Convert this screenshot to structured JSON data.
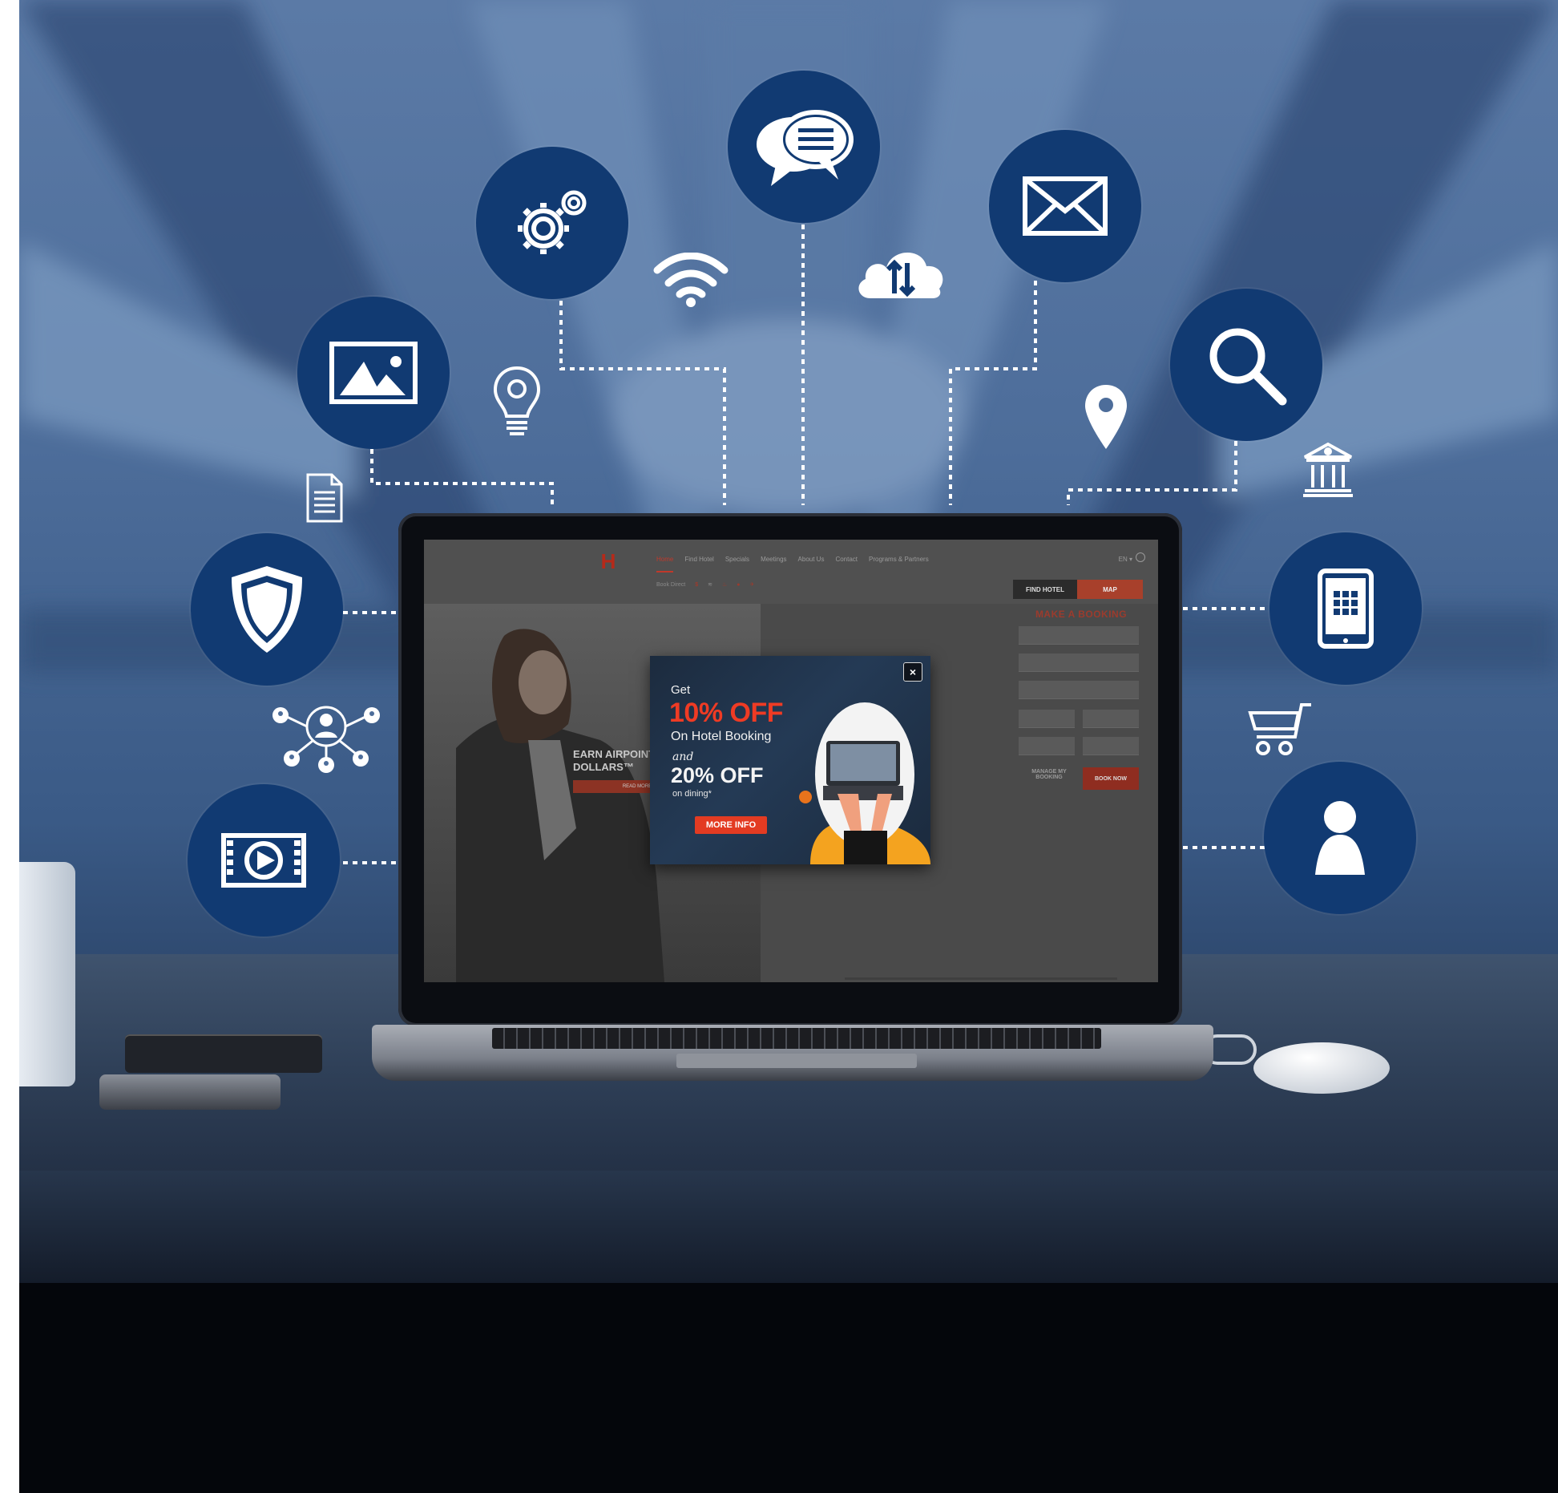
{
  "image": {
    "description_label": "",
    "colors": {
      "icon_circle": "#113a72",
      "brand_red": "#e33b22",
      "scene_blue": "#4d6d9a"
    }
  },
  "icons": {
    "circle_icons": [
      "gears-icon",
      "chat-icon",
      "mail-icon",
      "image-icon",
      "search-icon",
      "shield-icon",
      "tablet-icon",
      "video-icon",
      "user-icon"
    ],
    "free_icons": [
      "wifi-icon",
      "cloud-sync-icon",
      "lightbulb-icon",
      "location-pin-icon",
      "bank-icon",
      "document-icon",
      "network-icon",
      "cart-icon"
    ]
  },
  "website": {
    "nav": [
      "Home",
      "Find Hotel",
      "Specials",
      "Meetings",
      "About Us",
      "Contact",
      "Programs & Partners"
    ],
    "lang": "EN ▾",
    "book_direct_label": "Book Direct",
    "find_hotel_label": "FIND HOTEL",
    "map_label": "MAP",
    "booking_title": "MAKE A BOOKING",
    "manage_booking_label": "MANAGE MY BOOKING",
    "book_now_label": "BOOK NOW",
    "hero_title": "EARN AIRPOINTS DOLLARS™",
    "hero_cta": "READ MORE"
  },
  "popup": {
    "get": "Get",
    "offer1": "10% OFF",
    "sub1": "On Hotel Booking",
    "and": "and",
    "offer2": "20% OFF",
    "sub2": "on dining*",
    "more_info": "MORE INFO",
    "close": "×"
  }
}
